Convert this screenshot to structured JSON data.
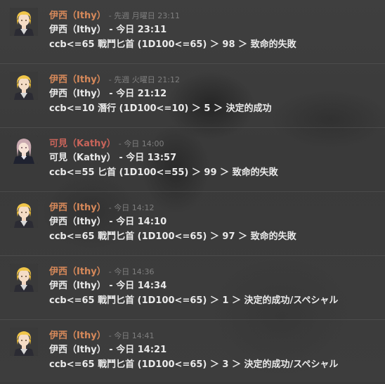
{
  "messages": [
    {
      "name": "伊西（Ithy）",
      "meta": "- 先週 月曜日 23:11",
      "line1": "伊西（Ithy） - 今日 23:11",
      "line2": "ccb<=65 戰鬥匕首 (1D100<=65) ＞ 98 ＞ 致命的失敗",
      "avatar": "blond-character"
    },
    {
      "name": "伊西（Ithy）",
      "meta": "- 先週 火曜日 21:12",
      "line1": "伊西（Ithy） - 今日 21:12",
      "line2": "ccb<=10 潛行 (1D100<=10) ＞ 5 ＞ 決定的成功",
      "avatar": "blond-character"
    },
    {
      "name": "可見（Kathy）",
      "meta": "- 今日 14:00",
      "line1": "可見（Kathy） - 今日 13:57",
      "line2": "ccb<=55 匕首 (1D100<=55) ＞ 99 ＞ 致命的失敗",
      "avatar": "pink-hair-character"
    },
    {
      "name": "伊西（Ithy）",
      "meta": "- 今日 14:12",
      "line1": "伊西（Ithy） - 今日 14:10",
      "line2": "ccb<=65 戰鬥匕首 (1D100<=65) ＞ 97 ＞ 致命的失敗",
      "avatar": "blond-character"
    },
    {
      "name": "伊西（Ithy）",
      "meta": "- 今日 14:36",
      "line1": "伊西（Ithy） - 今日 14:34",
      "line2": "ccb<=65 戰鬥匕首 (1D100<=65) ＞ 1 ＞ 決定的成功/スペシャル",
      "avatar": "blond-character"
    },
    {
      "name": "伊西（Ithy）",
      "meta": "- 今日 14:41",
      "line1": "伊西（Ithy） - 今日 14:21",
      "line2": "ccb<=65 戰鬥匕首 (1D100<=65) ＞ 3 ＞ 決定的成功/スペシャル",
      "avatar": "blond-character"
    }
  ]
}
